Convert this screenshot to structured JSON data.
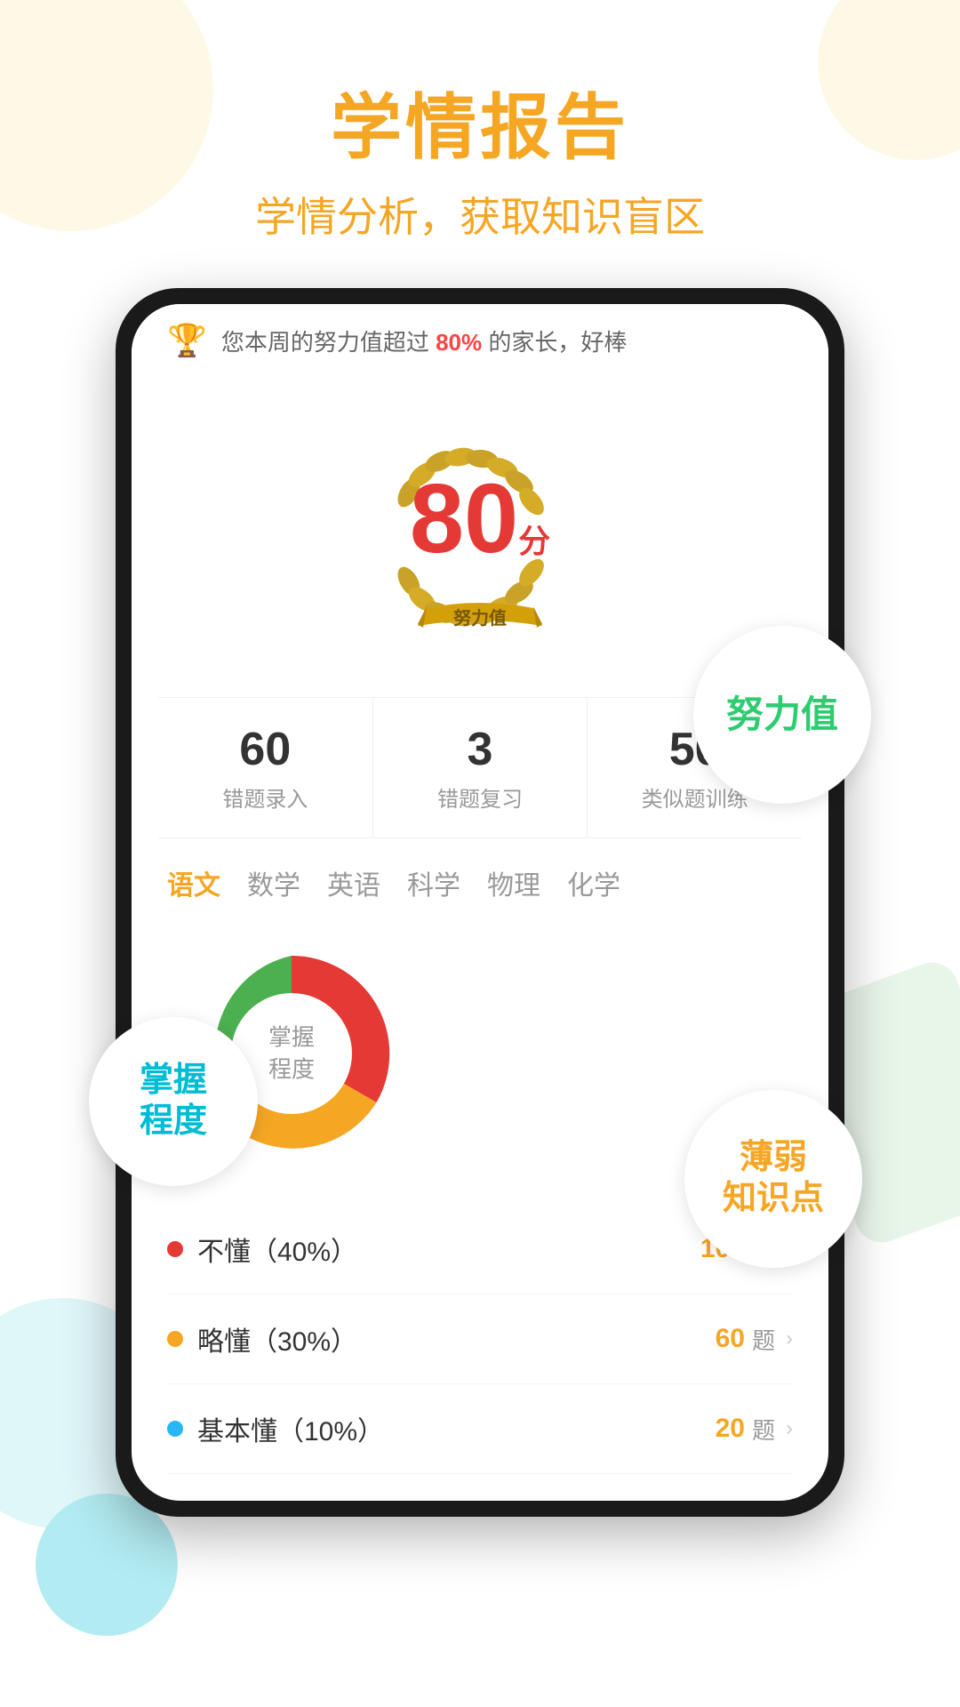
{
  "page": {
    "title": "学情报告",
    "subtitle": "学情分析，获取知识盲区"
  },
  "notification": {
    "text": "您本周的努力值超过",
    "highlight": "80%",
    "suffix": "的家长，好棒"
  },
  "score": {
    "number": "80",
    "unit": "分",
    "label": "努力值"
  },
  "stats": [
    {
      "number": "60",
      "label": "错题录入"
    },
    {
      "number": "3",
      "label": "错题复习"
    },
    {
      "number": "50",
      "label": "类似题训练"
    }
  ],
  "subjects": [
    {
      "label": "语文",
      "active": true
    },
    {
      "label": "数学",
      "active": false
    },
    {
      "label": "英语",
      "active": false
    },
    {
      "label": "科学",
      "active": false
    },
    {
      "label": "物理",
      "active": false
    },
    {
      "label": "化学",
      "active": false
    }
  ],
  "chart": {
    "center_text": "掌握\n程度",
    "segments": [
      {
        "label": "不懂",
        "color": "#e53935",
        "percent": 40,
        "degrees": 144
      },
      {
        "label": "略懂",
        "color": "#f5a623",
        "percent": 30,
        "degrees": 108
      },
      {
        "label": "基本懂",
        "color": "#29b6f6",
        "percent": 10,
        "degrees": 36
      },
      {
        "label": "掌握",
        "color": "#4caf50",
        "percent": 20,
        "degrees": 72
      }
    ]
  },
  "legend": [
    {
      "label": "不懂（40%）",
      "color": "#e53935",
      "count": "100",
      "unit": "题",
      "count_color": "#f5a623"
    },
    {
      "label": "略懂（30%）",
      "color": "#f5a623",
      "count": "60",
      "unit": "题",
      "count_color": "#f5a623"
    },
    {
      "label": "基本懂（10%）",
      "color": "#29b6f6",
      "count": "20",
      "unit": "题",
      "count_color": "#f5a623"
    }
  ],
  "float_badges": {
    "nuli": "努力值",
    "zhangwo": "掌握\n程度",
    "ruodian": "薄弱\n知识点"
  },
  "colors": {
    "orange": "#f5a623",
    "green": "#2ecc71",
    "cyan": "#00bcd4",
    "red": "#e53935"
  }
}
